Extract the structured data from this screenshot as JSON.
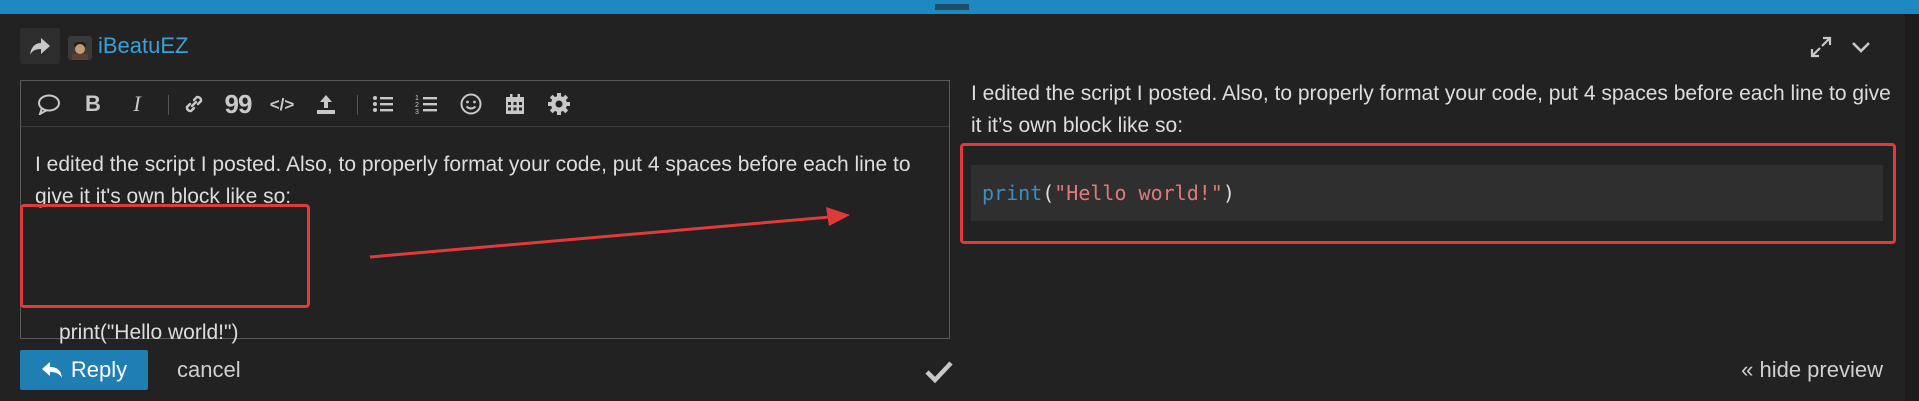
{
  "header": {
    "username": "iBeatuEZ",
    "icons": [
      "reply-share-icon",
      "avatar",
      "expand-icon",
      "chevron-down-icon"
    ]
  },
  "toolbar": {
    "buttons": [
      {
        "name": "quote",
        "icon": "speech-bubble-icon"
      },
      {
        "name": "bold",
        "label": "B"
      },
      {
        "name": "italic",
        "label": "I"
      },
      {
        "name": "link",
        "icon": "link-icon"
      },
      {
        "name": "blockquote",
        "label": "99"
      },
      {
        "name": "code",
        "label": "</>"
      },
      {
        "name": "upload",
        "icon": "upload-icon"
      },
      {
        "name": "bullet-list",
        "icon": "bullet-list-icon"
      },
      {
        "name": "numbered-list",
        "icon": "numbered-list-icon"
      },
      {
        "name": "emoji",
        "icon": "smiley-icon"
      },
      {
        "name": "date",
        "icon": "calendar-icon"
      },
      {
        "name": "options",
        "icon": "gear-icon"
      }
    ]
  },
  "editor": {
    "text": "I edited the script I posted. Also, to properly format your code, put 4 spaces before each line to give it it's own block like so:",
    "code_line": "print(\"Hello world!\")"
  },
  "preview": {
    "text": "I edited the script I posted. Also, to properly format your code, put 4 spaces before each line to give it it’s own block like so:",
    "code": {
      "fn": "print",
      "open": "(",
      "str": "\"Hello world!\"",
      "close": ")"
    }
  },
  "footer": {
    "reply_label": "Reply",
    "cancel_label": "cancel",
    "hide_preview_label": "« hide preview"
  },
  "colors": {
    "accent": "#1f7fb3",
    "link": "#3aa0d8",
    "annotation": "#e03a3a",
    "background": "#222222"
  }
}
